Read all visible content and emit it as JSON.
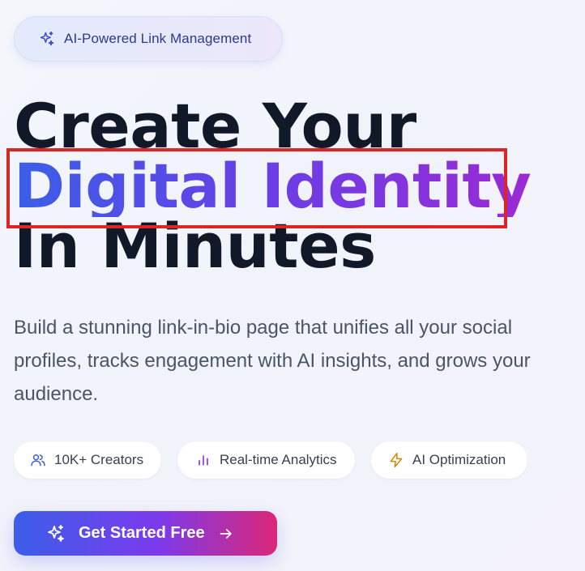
{
  "badge": {
    "label": "AI-Powered Link Management",
    "icon": "sparkles-icon"
  },
  "headline": {
    "line1": "Create Your",
    "line2": "Digital Identity",
    "line3": "In Minutes"
  },
  "subheading": "Build a stunning link-in-bio page that unifies all your social profiles, tracks engagement with AI insights, and grows your audience.",
  "features": [
    {
      "label": "10K+ Creators",
      "icon": "users-icon"
    },
    {
      "label": "Real-time Analytics",
      "icon": "bar-chart-icon"
    },
    {
      "label": "AI Optimization",
      "icon": "lightning-icon"
    }
  ],
  "cta": {
    "label": "Get Started Free",
    "icon": "sparkles-icon",
    "trailing_icon": "arrow-right-icon"
  },
  "colors": {
    "gradient_start": "#3b5ee8",
    "gradient_mid": "#7c3aed",
    "gradient_end": "#db2777",
    "highlight_border": "#dc2626",
    "headline_text": "#111827"
  }
}
